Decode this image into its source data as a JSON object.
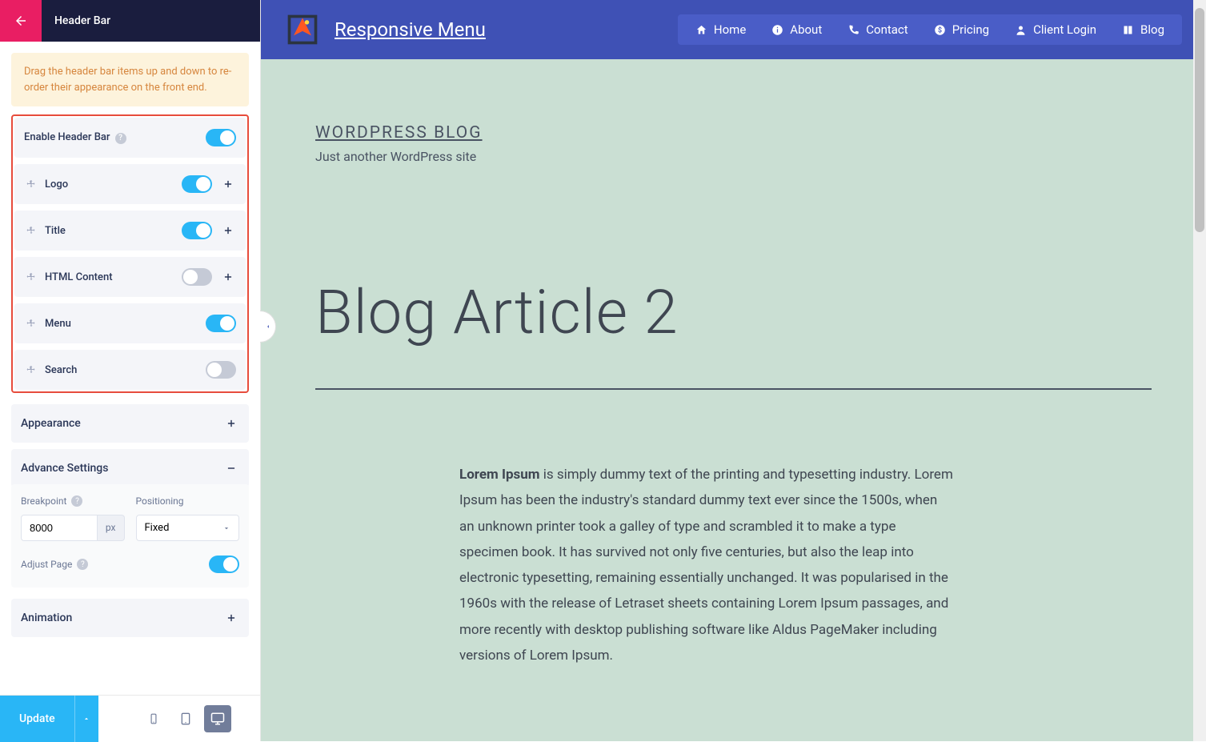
{
  "sidebar": {
    "title": "Header Bar",
    "notice": "Drag the header bar items up and down to re-order their appearance on the front end.",
    "enable_label": "Enable Header Bar",
    "enable_on": true,
    "items": [
      {
        "label": "Logo",
        "on": true,
        "expandable": true
      },
      {
        "label": "Title",
        "on": true,
        "expandable": true
      },
      {
        "label": "HTML Content",
        "on": false,
        "expandable": true
      },
      {
        "label": "Menu",
        "on": true,
        "expandable": false
      },
      {
        "label": "Search",
        "on": false,
        "expandable": false
      }
    ],
    "sections": {
      "appearance": "Appearance",
      "advance": "Advance Settings",
      "animation": "Animation"
    },
    "advance": {
      "breakpoint_label": "Breakpoint",
      "breakpoint_value": "8000",
      "breakpoint_unit": "px",
      "positioning_label": "Positioning",
      "positioning_value": "Fixed",
      "adjust_label": "Adjust Page",
      "adjust_on": true
    },
    "footer": {
      "update": "Update"
    }
  },
  "preview": {
    "brand": "Responsive Menu",
    "nav": [
      {
        "label": "Home",
        "icon": "home"
      },
      {
        "label": "About",
        "icon": "info"
      },
      {
        "label": "Contact",
        "icon": "phone"
      },
      {
        "label": "Pricing",
        "icon": "dollar"
      },
      {
        "label": "Client Login",
        "icon": "user"
      },
      {
        "label": "Blog",
        "icon": "book"
      }
    ],
    "site_title": "WORDPRESS BLOG",
    "tagline": "Just another WordPress site",
    "article_title": "Blog Article 2",
    "body_lead": "Lorem Ipsum",
    "body_rest": " is simply dummy text of the printing and typesetting industry. Lorem Ipsum has been the industry's standard dummy text ever since the 1500s, when an unknown printer took a galley of type and scrambled it to make a type specimen book. It has survived not only five centuries, but also the leap into electronic typesetting, remaining essentially unchanged. It was popularised in the 1960s with the release of Letraset sheets containing Lorem Ipsum passages, and more recently with desktop publishing software like Aldus PageMaker including versions of Lorem Ipsum."
  }
}
